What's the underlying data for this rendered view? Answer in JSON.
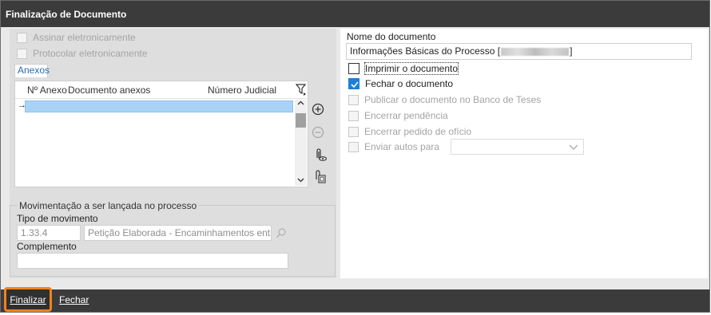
{
  "window": {
    "title": "Finalização de Documento"
  },
  "left": {
    "assinar_label": "Assinar eletronicamente",
    "protocolar_label": "Protocolar eletronicamente",
    "anexos_tab": "Anexos",
    "grid": {
      "columns": [
        "Nº Anexo",
        "Documento anexos",
        "Número Judicial"
      ],
      "row_marker": "→"
    },
    "movimentacao": {
      "legend": "Movimentação a ser lançada no processo",
      "tipo_label": "Tipo de movimento",
      "tipo_code": "1.33.4",
      "tipo_desc": "Petição Elaborada - Encaminhamentos entre c",
      "complemento_label": "Complemento",
      "complemento_value": ""
    }
  },
  "right": {
    "nome_label": "Nome do documento",
    "nome_prefix": "Informações Básicas do Processo [",
    "nome_suffix": "]",
    "options": {
      "imprimir": "Imprimir o documento",
      "fechar": "Fechar o documento",
      "publicar": "Publicar o documento no Banco de Teses",
      "encerrar_pendencia": "Encerrar pendência",
      "encerrar_pedido": "Encerrar pedido de ofício",
      "enviar_autos": "Enviar autos para"
    },
    "enviar_autos_value": ""
  },
  "footer": {
    "finalizar_label": "Finalizar",
    "fechar_label": "Fechar"
  },
  "colors": {
    "titlebar": "#3b3b3b",
    "accent_blue": "#1e7fd6",
    "selection": "#a9d3f6",
    "focus_orange": "#f0821e"
  }
}
